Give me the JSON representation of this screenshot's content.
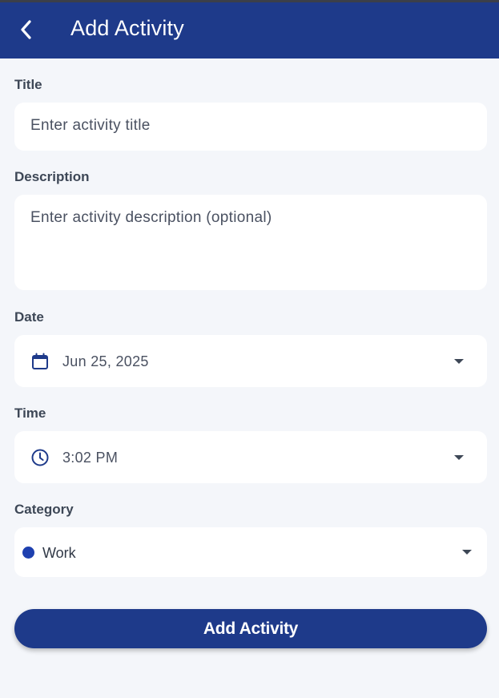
{
  "colors": {
    "primary": "#1e3a8a",
    "background": "#f4f6fa",
    "category_work": "#1e40af"
  },
  "appbar": {
    "title": "Add Activity",
    "back_icon": "chevron-left-icon"
  },
  "form": {
    "title": {
      "label": "Title",
      "placeholder": "Enter activity title",
      "value": ""
    },
    "description": {
      "label": "Description",
      "placeholder": "Enter activity description (optional)",
      "value": ""
    },
    "date": {
      "label": "Date",
      "icon": "calendar-icon",
      "value": "Jun 25, 2025"
    },
    "time": {
      "label": "Time",
      "icon": "clock-icon",
      "value": "3:02 PM"
    },
    "category": {
      "label": "Category",
      "value": "Work"
    }
  },
  "submit": {
    "label": "Add Activity"
  }
}
